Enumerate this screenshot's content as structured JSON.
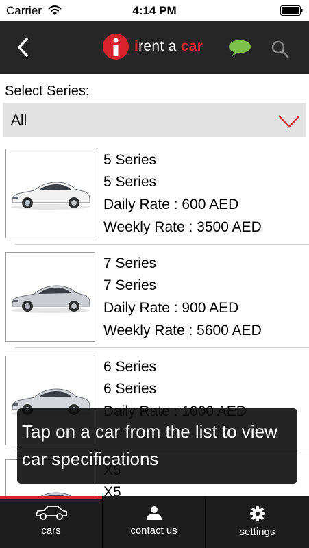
{
  "status_bar": {
    "carrier": "Carrier",
    "time": "4:14 PM"
  },
  "header": {
    "logo_i": "i",
    "logo_text": "rent a ",
    "logo_accent": "car",
    "accent_color": "#d9232d",
    "icons": [
      "back-arrow-icon",
      "chat-bubble-icon",
      "search-icon"
    ]
  },
  "series_filter": {
    "label": "Select Series:",
    "selected": "All"
  },
  "cars": [
    {
      "title": "5 Series",
      "subtitle": "5 Series",
      "daily": "Daily Rate : 600 AED",
      "weekly": "Weekly Rate : 3500 AED",
      "color": "#f2f2f2"
    },
    {
      "title": "7 Series",
      "subtitle": "7 Series",
      "daily": "Daily Rate : 900 AED",
      "weekly": "Weekly Rate : 5600 AED",
      "color": "#c9ccd1"
    },
    {
      "title": "6 Series",
      "subtitle": "6 Series",
      "daily": "Daily Rate : 1000 AED",
      "weekly": "",
      "color": "#d3d6da"
    },
    {
      "title": "X5",
      "subtitle": "X5",
      "daily": "",
      "weekly": "",
      "color": "#c9ccd1"
    }
  ],
  "toast": {
    "message": "Tap on a car from the list to view car specifications"
  },
  "tabs": [
    {
      "label": "cars",
      "icon": "car-icon",
      "active": true
    },
    {
      "label": "contact us",
      "icon": "person-icon",
      "active": false
    },
    {
      "label": "settings",
      "icon": "gear-icon",
      "active": false
    }
  ]
}
